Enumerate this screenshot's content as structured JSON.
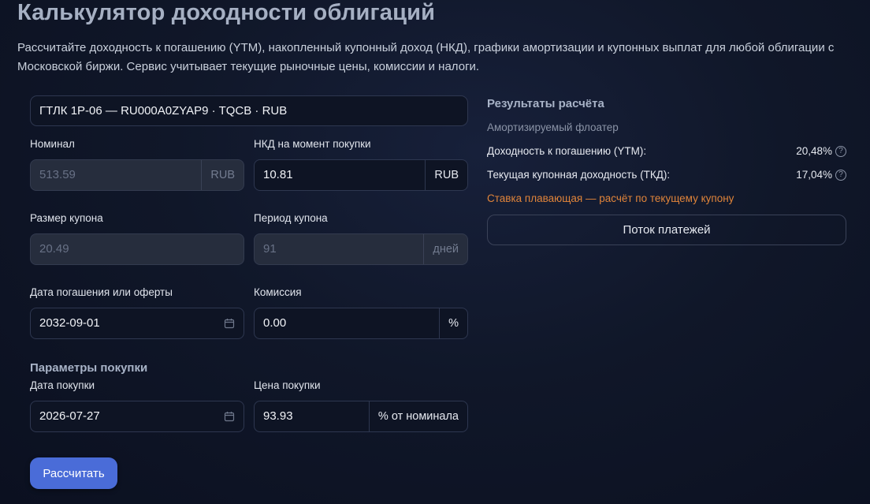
{
  "title": "Калькулятор доходности облигаций",
  "description": "Рассчитайте доходность к погашению (YTM), накопленный купонный доход (НКД), графики амортизации и купонных выплат для любой облигации с Московской биржи. Сервис учитывает текущие рыночные цены, комиссии и налоги.",
  "bond": {
    "selected": "ГТЛК 1Р-06 — RU000A0ZYAP9 · TQCB · RUB"
  },
  "form": {
    "nominal": {
      "label": "Номинал",
      "value": "513.59",
      "unit": "RUB"
    },
    "nkd": {
      "label": "НКД на момент покупки",
      "value": "10.81",
      "unit": "RUB"
    },
    "coupon_size": {
      "label": "Размер купона",
      "value": "20.49"
    },
    "coupon_period": {
      "label": "Период купона",
      "value": "91",
      "unit": "дней"
    },
    "maturity_date": {
      "label": "Дата погашения или оферты",
      "value": "2032-09-01"
    },
    "commission": {
      "label": "Комиссия",
      "value": "0.00",
      "unit": "%"
    },
    "purchase_section": "Параметры покупки",
    "purchase_date": {
      "label": "Дата покупки",
      "value": "2026-07-27"
    },
    "purchase_price": {
      "label": "Цена покупки",
      "value": "93.93",
      "unit": "% от номинала"
    },
    "calculate_label": "Рассчитать"
  },
  "results": {
    "title": "Результаты расчёта",
    "bond_type": "Амортизируемый флоатер",
    "ytm_label": "Доходность к погашению (YTM):",
    "ytm_value": "20,48%",
    "tkd_label": "Текущая купонная доходность (ТКД):",
    "tkd_value": "17,04%",
    "warning": "Ставка плавающая — расчёт по текущему купону",
    "flow_button": "Поток платежей"
  },
  "colors": {
    "accent": "#4a6cd8",
    "warning": "#e0843a",
    "background": "#101729"
  }
}
